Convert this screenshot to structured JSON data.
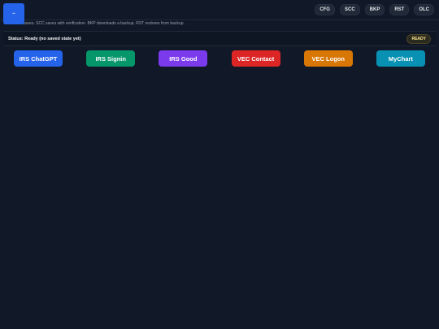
{
  "header": {
    "logo_text": "▪▪",
    "nav": [
      "CFG",
      "SCC",
      "BKP",
      "RST",
      "OLC"
    ]
  },
  "description": "ACC auto-saves. SCC saves with verification. BKP downloads a backup. RST restores from backup.",
  "status": {
    "text": "Status: Ready (no saved state yet)",
    "badge": "READY"
  },
  "actions": [
    {
      "label": "IRS ChatGPT",
      "color": "#2563eb"
    },
    {
      "label": "IRS Signin",
      "color": "#059669"
    },
    {
      "label": "IRS Good",
      "color": "#7c3aed"
    },
    {
      "label": "VEC Contact",
      "color": "#dc2626"
    },
    {
      "label": "VEC Logon",
      "color": "#d97706"
    },
    {
      "label": "MyChart",
      "color": "#0891b2"
    }
  ]
}
